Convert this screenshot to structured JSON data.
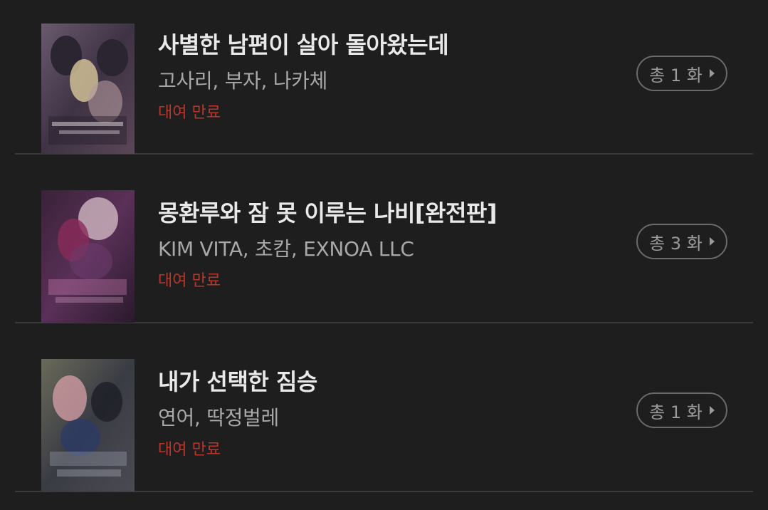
{
  "items": [
    {
      "title": "사별한 남편이 살아 돌아왔는데",
      "authors": "고사리, 부자, 나카체",
      "status": "대여 만료",
      "episodes": "총 1 화",
      "cover_colors": [
        "#5a4a5c",
        "#3a2f3e",
        "#c9a7b8"
      ]
    },
    {
      "title": "몽환루와 잠 못 이루는 나비[완전판]",
      "authors": "KIM VITA, 초캄, EXNOA LLC",
      "status": "대여 만료",
      "episodes": "총 3 화",
      "cover_colors": [
        "#4a2a4a",
        "#2a1830",
        "#c06a9a"
      ]
    },
    {
      "title": "내가 선택한 짐승",
      "authors": "연어, 딱정벌레",
      "status": "대여 만료",
      "episodes": "총 1 화",
      "cover_colors": [
        "#4c4a48",
        "#2c2f3a",
        "#d9a0a8"
      ]
    }
  ],
  "icons": {
    "episode_arrow": "chevron-right-icon"
  }
}
